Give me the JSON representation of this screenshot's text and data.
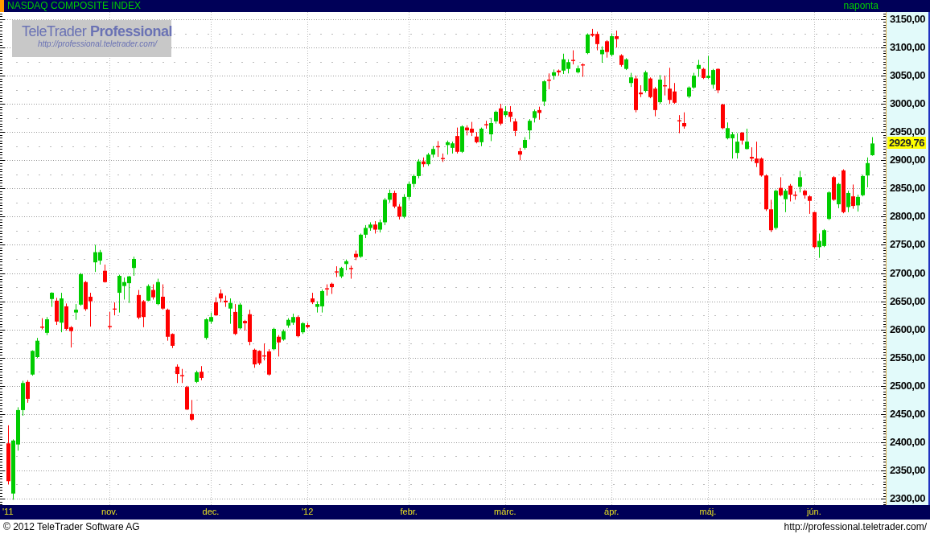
{
  "title_bar": {
    "title": "NASDAQ COMPOSITE INDEX",
    "interval": "naponta"
  },
  "logo": {
    "name": "TeleTrader **Professional**",
    "url": "http://professional.teletrader.com/"
  },
  "chart": {
    "last_price_label": "2929,76",
    "chart_data": {
      "type": "candlestick",
      "grid": true,
      "ylim": [
        2288.6,
        3162.8
      ],
      "yticks": [
        {
          "value": 2300,
          "label": "2300,00"
        },
        {
          "value": 2350,
          "label": "2350,00"
        },
        {
          "value": 2400,
          "label": "2400,00"
        },
        {
          "value": 2450,
          "label": "2450,00"
        },
        {
          "value": 2500,
          "label": "2500,00"
        },
        {
          "value": 2550,
          "label": "2550,00"
        },
        {
          "value": 2600,
          "label": "2600,00"
        },
        {
          "value": 2650,
          "label": "2650,00"
        },
        {
          "value": 2700,
          "label": "2700,00"
        },
        {
          "value": 2750,
          "label": "2750,00"
        },
        {
          "value": 2800,
          "label": "2800,00"
        },
        {
          "value": 2850,
          "label": "2850,00"
        },
        {
          "value": 2900,
          "label": "2900,00"
        },
        {
          "value": 2950,
          "label": "2950,00"
        },
        {
          "value": 3000,
          "label": "3000,00"
        },
        {
          "value": 3050,
          "label": "3050,00"
        },
        {
          "value": 3100,
          "label": "3100,00"
        },
        {
          "value": 3150,
          "label": "3150,00"
        }
      ],
      "categories": [
        "'11",
        null,
        null,
        null,
        null,
        null,
        null,
        null,
        null,
        null,
        null,
        null,
        null,
        null,
        null,
        null,
        null,
        null,
        null,
        null,
        null,
        "nov.",
        null,
        null,
        null,
        null,
        null,
        null,
        null,
        null,
        null,
        null,
        null,
        null,
        null,
        null,
        null,
        null,
        null,
        null,
        null,
        null,
        "dec.",
        null,
        null,
        null,
        null,
        null,
        null,
        null,
        null,
        null,
        null,
        null,
        null,
        null,
        null,
        null,
        null,
        null,
        null,
        null,
        "'12",
        null,
        null,
        null,
        null,
        null,
        null,
        null,
        null,
        null,
        null,
        null,
        null,
        null,
        null,
        null,
        null,
        null,
        null,
        null,
        null,
        "febr.",
        null,
        null,
        null,
        null,
        null,
        null,
        null,
        null,
        null,
        null,
        null,
        null,
        null,
        null,
        null,
        null,
        null,
        null,
        null,
        "márc.",
        null,
        null,
        null,
        null,
        null,
        null,
        null,
        null,
        null,
        null,
        null,
        null,
        null,
        null,
        null,
        null,
        null,
        null,
        null,
        null,
        null,
        "ápr.",
        null,
        null,
        null,
        null,
        null,
        null,
        null,
        null,
        null,
        null,
        null,
        null,
        null,
        null,
        null,
        null,
        null,
        null,
        null,
        "máj.",
        null,
        null,
        null,
        null,
        null,
        null,
        null,
        null,
        null,
        null,
        null,
        null,
        null,
        null,
        null,
        null,
        null,
        null,
        null,
        null,
        null,
        "jún.",
        null,
        null,
        null,
        null,
        null,
        null,
        null,
        null,
        null,
        null,
        null,
        null
      ],
      "ohlc": [
        [
          2398,
          2430,
          2325,
          2331
        ],
        [
          2309,
          2405,
          2298,
          2403
        ],
        [
          2396,
          2462,
          2385,
          2457
        ],
        [
          2457,
          2509,
          2447,
          2505
        ],
        [
          2507,
          2510,
          2470,
          2477
        ],
        [
          2520,
          2563,
          2518,
          2562
        ],
        [
          2551,
          2585,
          2549,
          2580
        ],
        [
          2605,
          2620,
          2600,
          2603
        ],
        [
          2594,
          2622,
          2590,
          2618
        ],
        [
          2654,
          2666,
          2640,
          2665
        ],
        [
          2651,
          2656,
          2608,
          2614
        ],
        [
          2612,
          2665,
          2595,
          2655
        ],
        [
          2641,
          2646,
          2598,
          2601
        ],
        [
          2604,
          2606,
          2568,
          2597
        ],
        [
          2630,
          2645,
          2617,
          2635
        ],
        [
          2644,
          2700,
          2642,
          2698
        ],
        [
          2684,
          2686,
          2633,
          2636
        ],
        [
          2658,
          2665,
          2605,
          2650
        ],
        [
          2719,
          2750,
          2702,
          2737
        ],
        [
          2722,
          2741,
          2715,
          2737
        ],
        [
          2704,
          2715,
          2683,
          2684
        ],
        [
          2606,
          2631,
          2600,
          2604
        ],
        [
          2637,
          2648,
          2625,
          2636
        ],
        [
          2665,
          2697,
          2630,
          2695
        ],
        [
          2677,
          2692,
          2653,
          2684
        ],
        [
          2682,
          2695,
          2647,
          2694
        ],
        [
          2709,
          2729,
          2695,
          2725
        ],
        [
          2661,
          2670,
          2618,
          2621
        ],
        [
          2650,
          2652,
          2604,
          2622
        ],
        [
          2651,
          2680,
          2650,
          2677
        ],
        [
          2670,
          2680,
          2653,
          2657
        ],
        [
          2645,
          2690,
          2643,
          2684
        ],
        [
          2658,
          2680,
          2635,
          2637
        ],
        [
          2635,
          2637,
          2580,
          2587
        ],
        [
          2592,
          2593,
          2567,
          2571
        ],
        [
          2534,
          2538,
          2505,
          2521
        ],
        [
          2519,
          2530,
          2505,
          2517
        ],
        [
          2498,
          2500,
          2457,
          2458
        ],
        [
          2450,
          2475,
          2438,
          2440
        ],
        [
          2507,
          2527,
          2505,
          2524
        ],
        [
          2525,
          2535,
          2510,
          2514
        ],
        [
          2585,
          2620,
          2582,
          2618
        ],
        [
          2614,
          2630,
          2610,
          2622
        ],
        [
          2648,
          2657,
          2624,
          2625
        ],
        [
          2664,
          2671,
          2648,
          2655
        ],
        [
          2651,
          2660,
          2640,
          2648
        ],
        [
          2637,
          2655,
          2610,
          2647
        ],
        [
          2631,
          2645,
          2590,
          2592
        ],
        [
          2602,
          2647,
          2600,
          2644
        ],
        [
          2615,
          2617,
          2598,
          2611
        ],
        [
          2627,
          2635,
          2572,
          2578
        ],
        [
          2564,
          2566,
          2532,
          2538
        ],
        [
          2562,
          2563,
          2537,
          2540
        ],
        [
          2554,
          2575,
          2545,
          2552
        ],
        [
          2561,
          2565,
          2518,
          2520
        ],
        [
          2565,
          2603,
          2563,
          2601
        ],
        [
          2587,
          2590,
          2552,
          2577
        ],
        [
          2582,
          2600,
          2580,
          2597
        ],
        [
          2607,
          2620,
          2603,
          2617
        ],
        [
          2612,
          2628,
          2608,
          2622
        ],
        [
          2622,
          2624,
          2586,
          2588
        ],
        [
          2595,
          2613,
          2592,
          2611
        ],
        [
          2608,
          2612,
          2602,
          2604
        ],
        [
          2655,
          2665,
          2645,
          2648
        ],
        [
          2640,
          2650,
          2630,
          2645
        ],
        [
          2641,
          2671,
          2630,
          2668
        ],
        [
          2673,
          2680,
          2660,
          2671
        ],
        [
          2681,
          2683,
          2663,
          2675
        ],
        [
          2703,
          2712,
          2693,
          2701
        ],
        [
          2694,
          2711,
          2691,
          2709
        ],
        [
          2716,
          2724,
          2705,
          2721
        ],
        [
          2709,
          2713,
          2690,
          2707
        ],
        [
          2734,
          2740,
          2723,
          2728
        ],
        [
          2729,
          2770,
          2727,
          2768
        ],
        [
          2768,
          2785,
          2762,
          2780
        ],
        [
          2780,
          2790,
          2775,
          2786
        ],
        [
          2786,
          2792,
          2770,
          2777
        ],
        [
          2777,
          2795,
          2772,
          2790
        ],
        [
          2790,
          2833,
          2785,
          2830
        ],
        [
          2830,
          2848,
          2825,
          2842
        ],
        [
          2842,
          2846,
          2815,
          2818
        ],
        [
          2818,
          2822,
          2795,
          2800
        ],
        [
          2800,
          2840,
          2797,
          2835
        ],
        [
          2835,
          2862,
          2830,
          2858
        ],
        [
          2858,
          2875,
          2852,
          2872
        ],
        [
          2872,
          2902,
          2868,
          2898
        ],
        [
          2898,
          2905,
          2888,
          2893
        ],
        [
          2893,
          2913,
          2890,
          2910
        ],
        [
          2910,
          2925,
          2905,
          2920
        ],
        [
          2925,
          2934,
          2906,
          2923
        ],
        [
          2904,
          2912,
          2897,
          2902
        ],
        [
          2927,
          2935,
          2910,
          2932
        ],
        [
          2922,
          2933,
          2912,
          2930
        ],
        [
          2943,
          2958,
          2912,
          2915
        ],
        [
          2915,
          2962,
          2913,
          2960
        ],
        [
          2958,
          2962,
          2944,
          2953
        ],
        [
          2956,
          2968,
          2943,
          2949
        ],
        [
          2942,
          2950,
          2930,
          2932
        ],
        [
          2932,
          2958,
          2925,
          2956
        ],
        [
          2964,
          2970,
          2956,
          2962
        ],
        [
          2946,
          2975,
          2934,
          2966
        ],
        [
          2969,
          2988,
          2965,
          2986
        ],
        [
          2992,
          3000,
          2962,
          2965
        ],
        [
          2980,
          2996,
          2976,
          2987
        ],
        [
          2986,
          2996,
          2968,
          2977
        ],
        [
          2969,
          2974,
          2943,
          2952
        ],
        [
          2916,
          2922,
          2900,
          2910
        ],
        [
          2922,
          2941,
          2919,
          2936
        ],
        [
          2953,
          2973,
          2937,
          2970
        ],
        [
          2975,
          2990,
          2967,
          2987
        ],
        [
          2989,
          2995,
          2972,
          2984
        ],
        [
          3004,
          3042,
          2996,
          3040
        ],
        [
          3043,
          3054,
          3026,
          3041
        ],
        [
          3050,
          3061,
          3043,
          3056
        ],
        [
          3059,
          3061,
          3050,
          3056
        ],
        [
          3059,
          3089,
          3053,
          3079
        ],
        [
          3062,
          3079,
          3054,
          3074
        ],
        [
          3078,
          3095,
          3070,
          3076
        ],
        [
          3056,
          3068,
          3054,
          3063
        ],
        [
          3070,
          3072,
          3048,
          3068
        ],
        [
          3090,
          3125,
          3088,
          3123
        ],
        [
          3124,
          3133,
          3119,
          3121
        ],
        [
          3124,
          3128,
          3095,
          3106
        ],
        [
          3088,
          3102,
          3073,
          3096
        ],
        [
          3111,
          3113,
          3082,
          3092
        ],
        [
          3087,
          3125,
          3084,
          3120
        ],
        [
          3120,
          3130,
          3100,
          3115
        ],
        [
          3086,
          3088,
          3066,
          3069
        ],
        [
          3062,
          3081,
          3060,
          3079
        ],
        [
          3037,
          3055,
          3030,
          3047
        ],
        [
          3045,
          3050,
          2985,
          2989
        ],
        [
          3020,
          3033,
          3012,
          3017
        ],
        [
          3023,
          3059,
          3020,
          3056
        ],
        [
          3045,
          3047,
          3010,
          3012
        ],
        [
          3027,
          3030,
          2978,
          2989
        ],
        [
          3003,
          3051,
          3000,
          3043
        ],
        [
          3033,
          3050,
          3015,
          3031
        ],
        [
          3027,
          3064,
          3000,
          3007
        ],
        [
          3022,
          3037,
          3000,
          3002
        ],
        [
          2971,
          2980,
          2948,
          2969
        ],
        [
          2966,
          2985,
          2956,
          2960
        ],
        [
          3013,
          3031,
          3010,
          3029
        ],
        [
          3029,
          3055,
          3027,
          3050
        ],
        [
          3062,
          3078,
          3048,
          3069
        ],
        [
          3062,
          3064,
          3044,
          3046
        ],
        [
          3046,
          3085,
          3044,
          3050
        ],
        [
          3034,
          3062,
          3027,
          3060
        ],
        [
          3062,
          3063,
          3019,
          3024
        ],
        [
          2999,
          3000,
          2955,
          2957
        ],
        [
          2939,
          2967,
          2937,
          2957
        ],
        [
          2939,
          2950,
          2903,
          2946
        ],
        [
          2913,
          2948,
          2903,
          2933
        ],
        [
          2949,
          2950,
          2928,
          2935
        ],
        [
          2920,
          2956,
          2919,
          2933
        ],
        [
          2906,
          2923,
          2898,
          2903
        ],
        [
          2903,
          2933,
          2888,
          2895
        ],
        [
          2903,
          2905,
          2871,
          2873
        ],
        [
          2873,
          2875,
          2810,
          2813
        ],
        [
          2813,
          2830,
          2773,
          2776
        ],
        [
          2780,
          2848,
          2777,
          2846
        ],
        [
          2851,
          2870,
          2836,
          2838
        ],
        [
          2831,
          2849,
          2808,
          2846
        ],
        [
          2855,
          2858,
          2827,
          2839
        ],
        [
          2839,
          2845,
          2830,
          2837
        ],
        [
          2853,
          2881,
          2843,
          2870
        ],
        [
          2846,
          2848,
          2832,
          2838
        ],
        [
          2836,
          2838,
          2805,
          2828
        ],
        [
          2808,
          2809,
          2744,
          2746
        ],
        [
          2746,
          2770,
          2727,
          2757
        ],
        [
          2748,
          2778,
          2746,
          2776
        ],
        [
          2796,
          2845,
          2794,
          2843
        ],
        [
          2870,
          2872,
          2828,
          2830
        ],
        [
          2822,
          2860,
          2815,
          2858
        ],
        [
          2882,
          2884,
          2806,
          2808
        ],
        [
          2817,
          2846,
          2808,
          2842
        ],
        [
          2836,
          2857,
          2814,
          2819
        ],
        [
          2820,
          2839,
          2809,
          2835
        ],
        [
          2838,
          2874,
          2836,
          2872
        ],
        [
          2873,
          2905,
          2852,
          2895
        ],
        [
          2909,
          2941,
          2908,
          2929.76
        ]
      ]
    }
  },
  "footer": {
    "copyright": "© 2012 TeleTrader Software AG",
    "url": "http://professional.teletrader.com/"
  }
}
